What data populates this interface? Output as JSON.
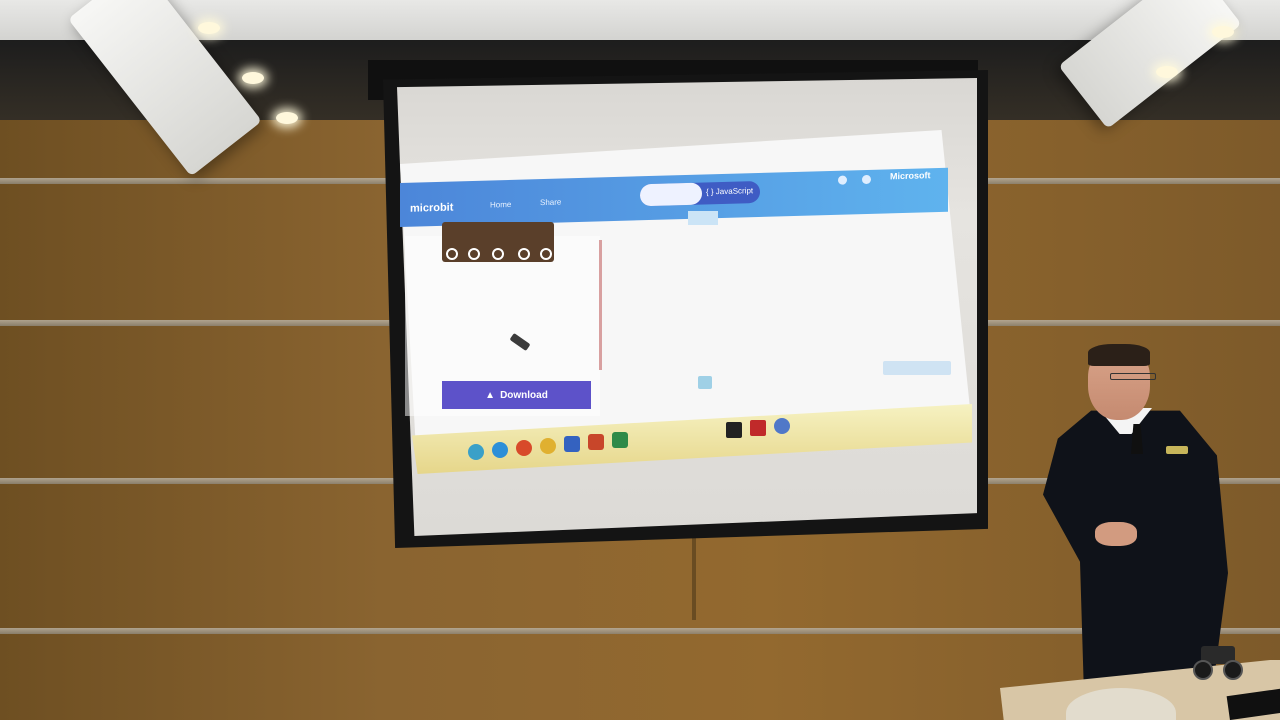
{
  "projected_app": {
    "logo_text": "microbit",
    "nav": {
      "home_label": "Home",
      "share_label": "Share"
    },
    "editor_toggle": {
      "javascript_label": "{ } JavaScript"
    },
    "brand_text": "Microsoft",
    "download_label": "Download",
    "icons": [
      "help-icon",
      "settings-icon",
      "download-icon"
    ]
  },
  "colors": {
    "topbar": "#5fb3ee",
    "download_button": "#5d52c9",
    "microbit_board": "#5a3f2a",
    "taskbar": "#f0e4a8"
  }
}
